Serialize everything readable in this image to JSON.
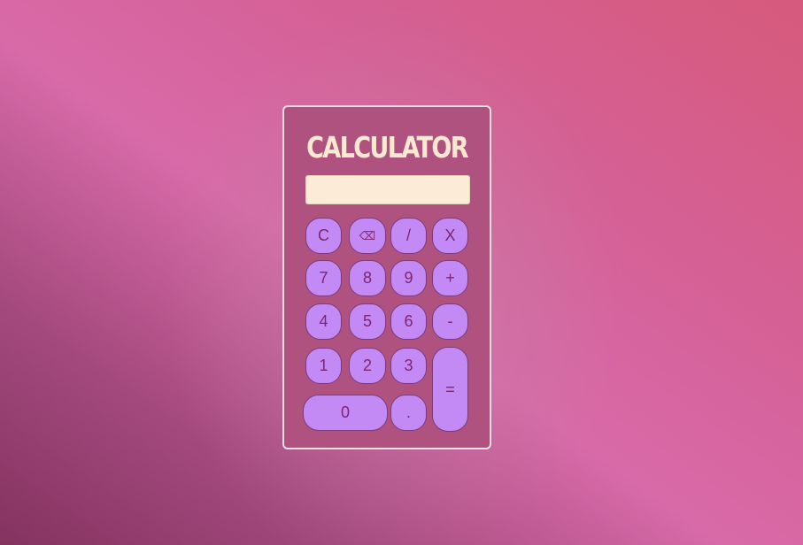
{
  "title": "CALCULATOR",
  "display": {
    "value": ""
  },
  "buttons": {
    "clear": "C",
    "backspace": "⌫",
    "divide": "/",
    "multiply": "X",
    "seven": "7",
    "eight": "8",
    "nine": "9",
    "plus": "+",
    "four": "4",
    "five": "5",
    "six": "6",
    "minus": "-",
    "one": "1",
    "two": "2",
    "three": "3",
    "equals": "=",
    "zero": "0",
    "decimal": "."
  },
  "colors": {
    "body": "#b0527f",
    "title": "#fde8d1",
    "display": "#fbebd7",
    "button": "#c38af5",
    "button_text": "#7c2570"
  }
}
